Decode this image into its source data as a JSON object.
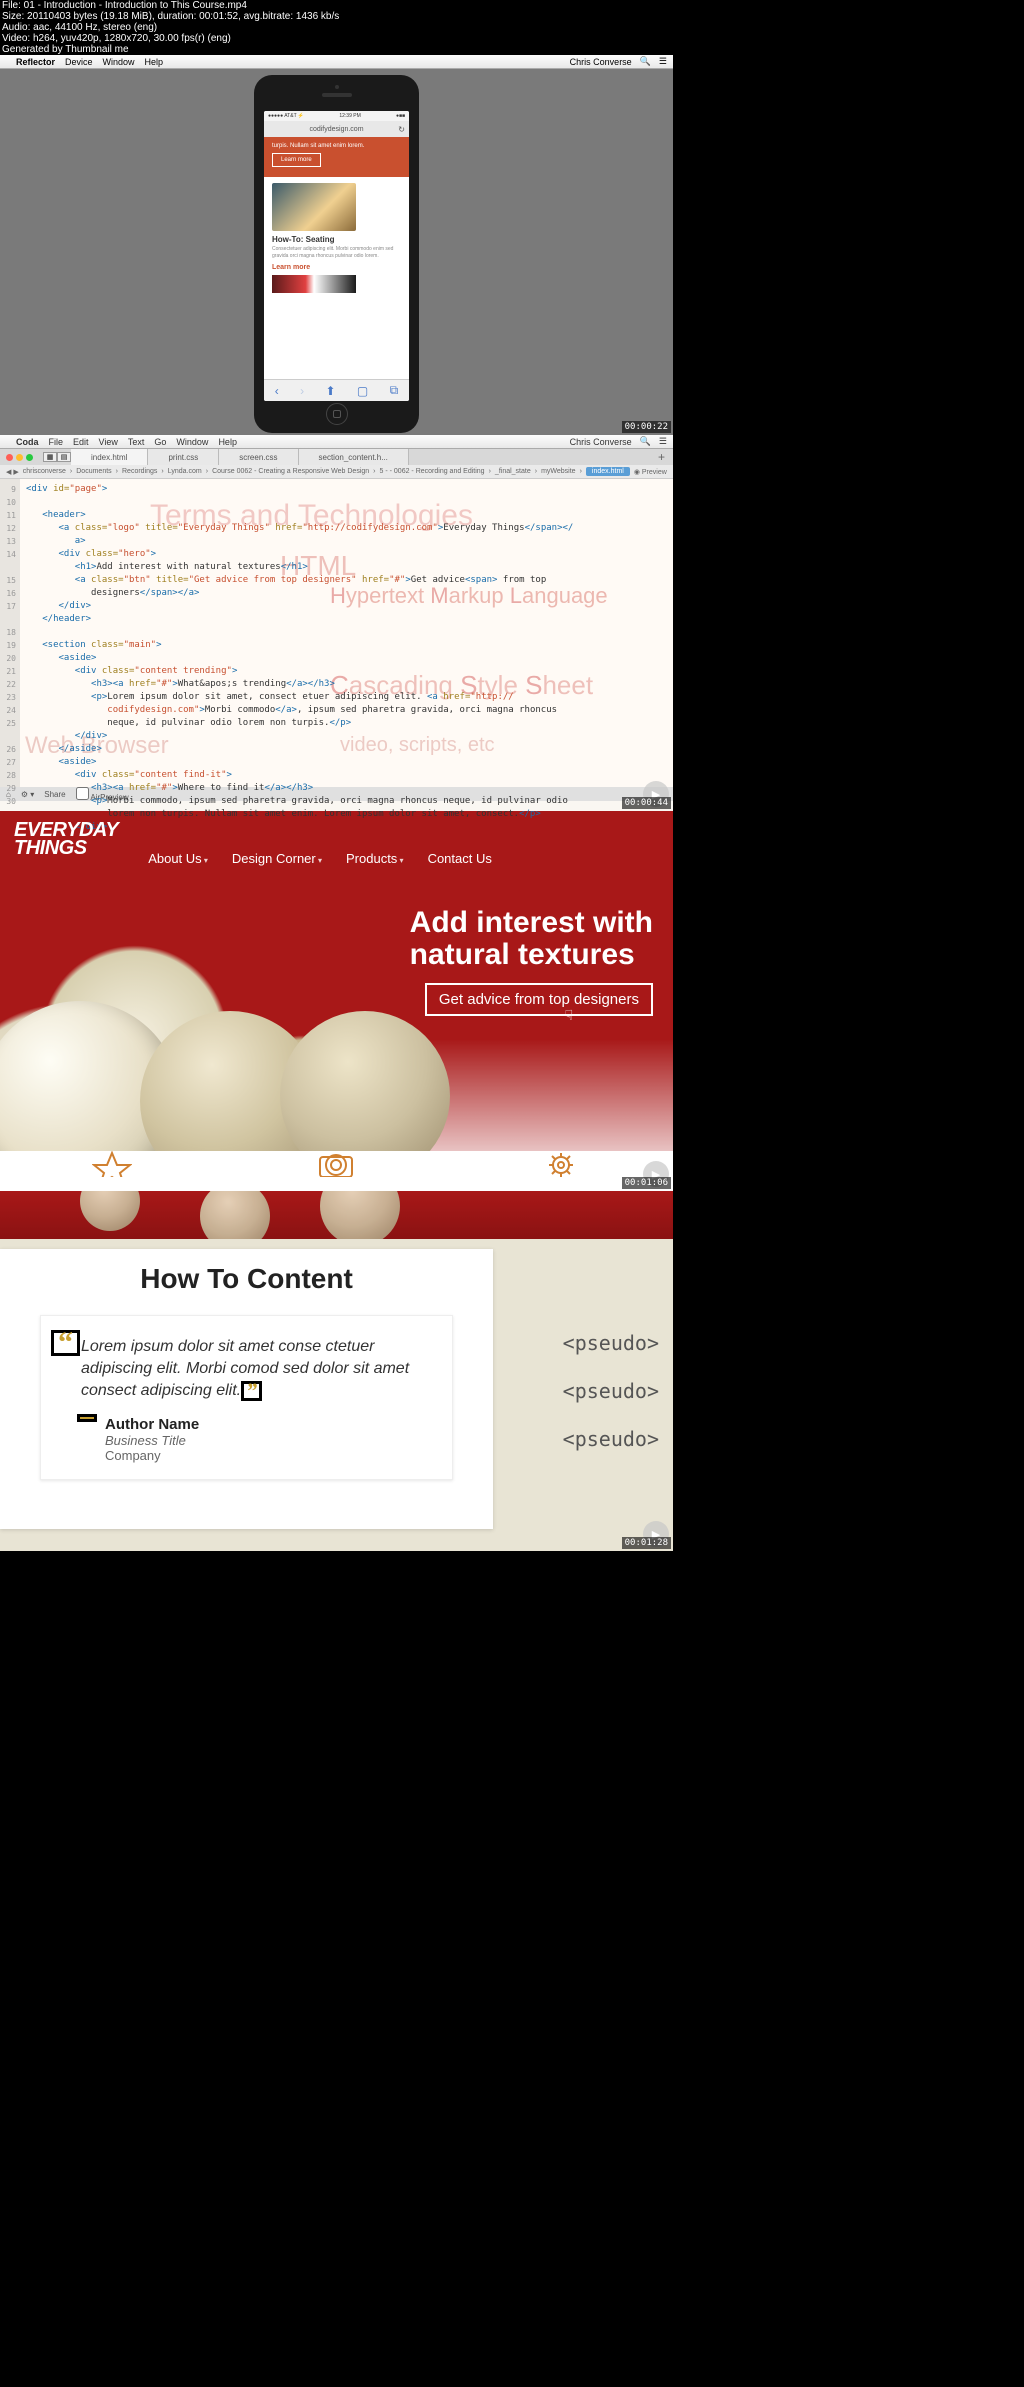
{
  "video_info": {
    "l1": "File: 01 - Introduction - Introduction to This Course.mp4",
    "l2": "Size: 20110403 bytes (19.18 MiB), duration: 00:01:52, avg.bitrate: 1436 kb/s",
    "l3": "Audio: aac, 44100 Hz, stereo (eng)",
    "l4": "Video: h264, yuv420p, 1280x720, 30.00 fps(r) (eng)",
    "l5": "Generated by Thumbnail me"
  },
  "menubar1": {
    "app": "Reflector",
    "items": [
      "Device",
      "Window",
      "Help"
    ],
    "user": "Chris Converse"
  },
  "phone": {
    "status_left": "●●●●● AT&T ⚡",
    "status_time": "12:39 PM",
    "status_right": "●■■",
    "url": "codifydesign.com",
    "hero_text": "turpis. Nullam sit amet enim lorem.",
    "hero_btn": "Learn more",
    "card_title": "How-To: Seating",
    "card_text": "Consectetuer adipiscing elit. Morbi commodo enim sed gravida orci magna rhoncus pulvinar odio lorem.",
    "card_link": "Learn more"
  },
  "ts1": "00:00:22",
  "menubar2": {
    "app": "Coda",
    "items": [
      "File",
      "Edit",
      "View",
      "Text",
      "Go",
      "Window",
      "Help"
    ],
    "user": "Chris Converse"
  },
  "editor": {
    "tabs": [
      "index.html",
      "print.css",
      "screen.css",
      "section_content.h..."
    ],
    "breadcrumb": [
      "chrisconverse",
      "Documents",
      "Recordings",
      "Lynda.com",
      "Course 0062 - Creating a Responsive Web Design",
      "5 - - 0062 - Recording and Editing",
      "_final_state",
      "myWebsite",
      "index.html",
      "Preview"
    ],
    "ghost1": "Terms and Technologies",
    "ghost2": "HTML",
    "ghost2b": "Hypertext Markup Language",
    "ghost3": "Cascading Style Sheet",
    "ghost4": "Web Browser",
    "ghost4b": "video, scripts, etc",
    "bottom": [
      "⌂",
      "⚙ ▾",
      "Share",
      "AirPreview"
    ]
  },
  "ts2": "00:00:44",
  "hero": {
    "logo1": "EVERYDAY",
    "logo2": "THINGS",
    "nav": [
      "About Us",
      "Design Corner",
      "Products",
      "Contact Us"
    ],
    "h1a": "Add interest with",
    "h1b": "natural textures",
    "btn": "Get advice from top designers"
  },
  "ts3": "00:01:06",
  "howto": {
    "title": "How To Content",
    "quote": "Lorem ipsum dolor sit amet conse ctetuer adipiscing elit. Morbi comod sed dolor sit amet consect adipiscing elit.",
    "author": "Author Name",
    "biz": "Business Title",
    "co": "Company",
    "pseudo": "<pseudo>"
  },
  "ts4": "00:01:28"
}
